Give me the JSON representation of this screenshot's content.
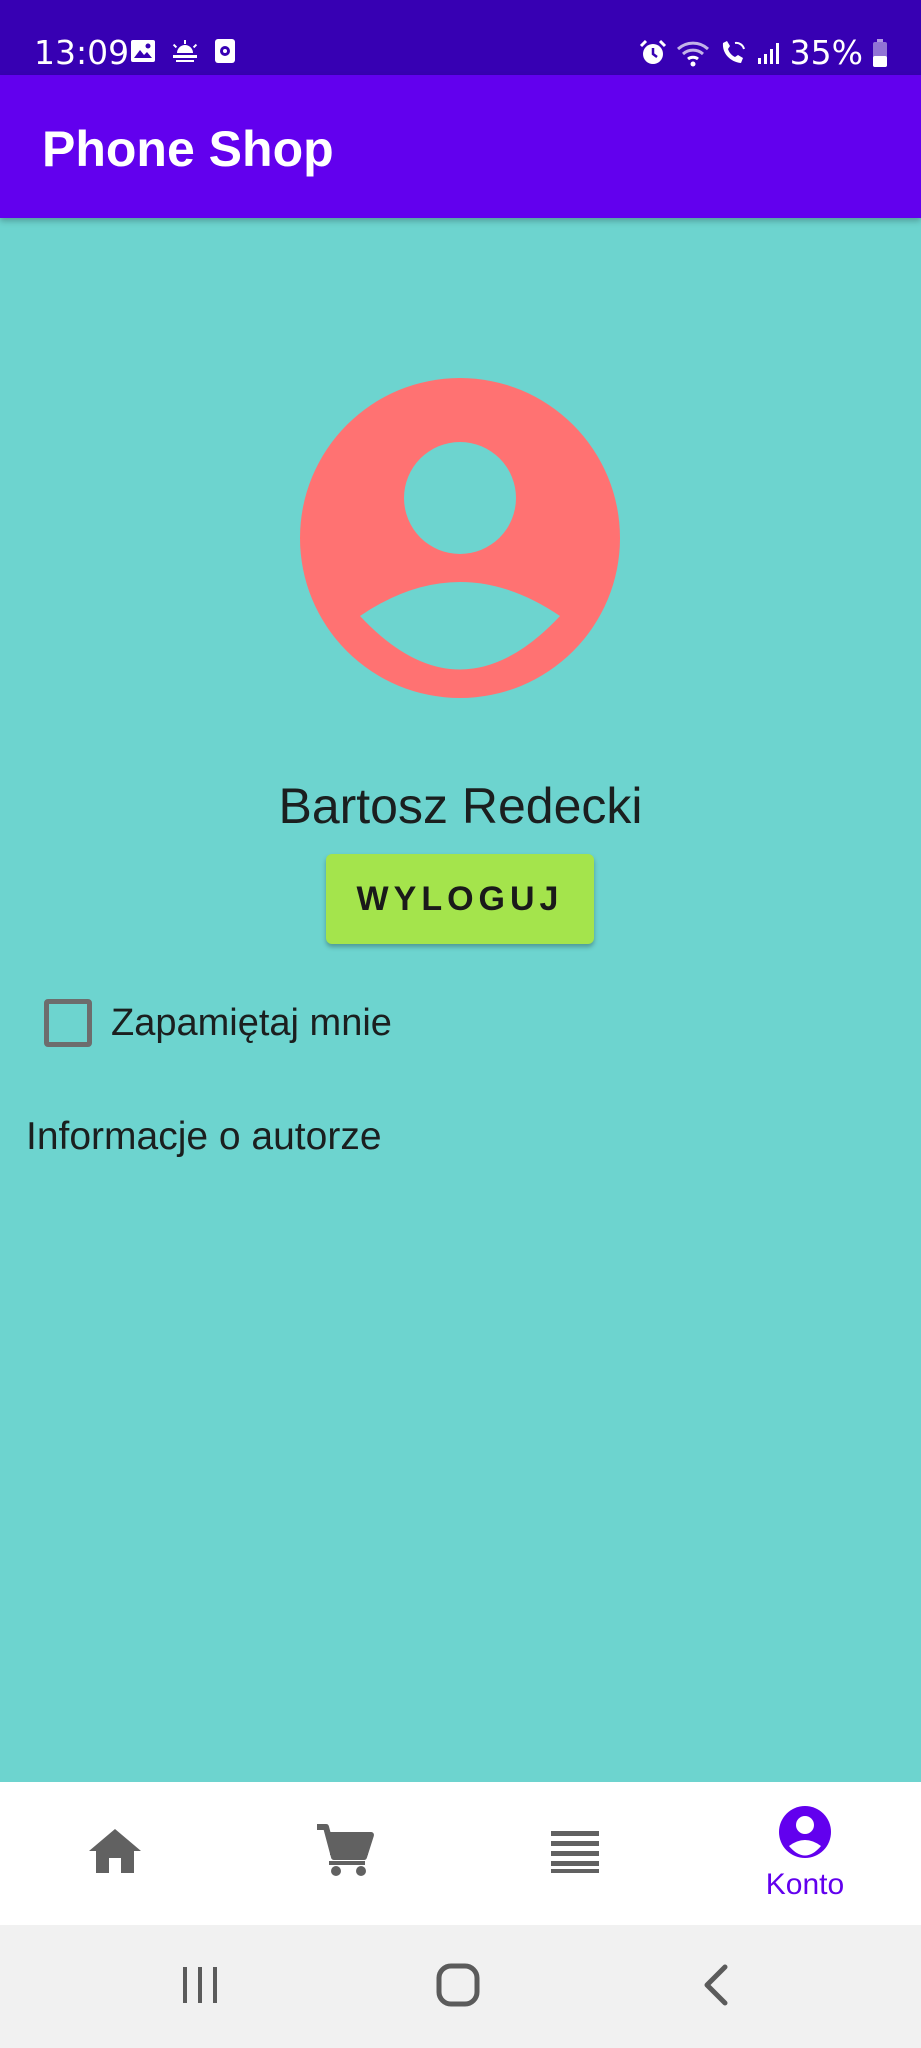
{
  "status_bar": {
    "time": "13:09",
    "battery": "35%",
    "left_icons": [
      "gallery-icon",
      "weather-icon",
      "screen-recorder-icon"
    ],
    "right_icons": [
      "alarm-icon",
      "wifi-icon",
      "wifi-calling-icon",
      "signal-icon",
      "battery-icon"
    ]
  },
  "app_bar": {
    "title": "Phone Shop"
  },
  "profile": {
    "avatar_icon": "account-circle-icon",
    "avatar_color": "#ff7272",
    "name": "Bartosz Redecki",
    "logout_label": "WYLOGUJ",
    "remember_label": "Zapamiętaj mnie",
    "remember_checked": false,
    "author_info_label": "Informacje o autorze"
  },
  "bottom_nav": {
    "items": [
      {
        "icon": "home-icon",
        "label": "",
        "active": false
      },
      {
        "icon": "cart-icon",
        "label": "",
        "active": false
      },
      {
        "icon": "list-icon",
        "label": "",
        "active": false
      },
      {
        "icon": "account-circle-icon",
        "label": "Konto",
        "active": true
      }
    ]
  },
  "system_nav": {
    "items": [
      "recents-icon",
      "home-button-icon",
      "back-icon"
    ]
  },
  "colors": {
    "status_bar": "#3700b3",
    "app_bar": "#6200ee",
    "background": "#6dd4cf",
    "logout_button": "#a4e44c",
    "nav_active": "#6200ee",
    "nav_inactive": "#616161"
  }
}
